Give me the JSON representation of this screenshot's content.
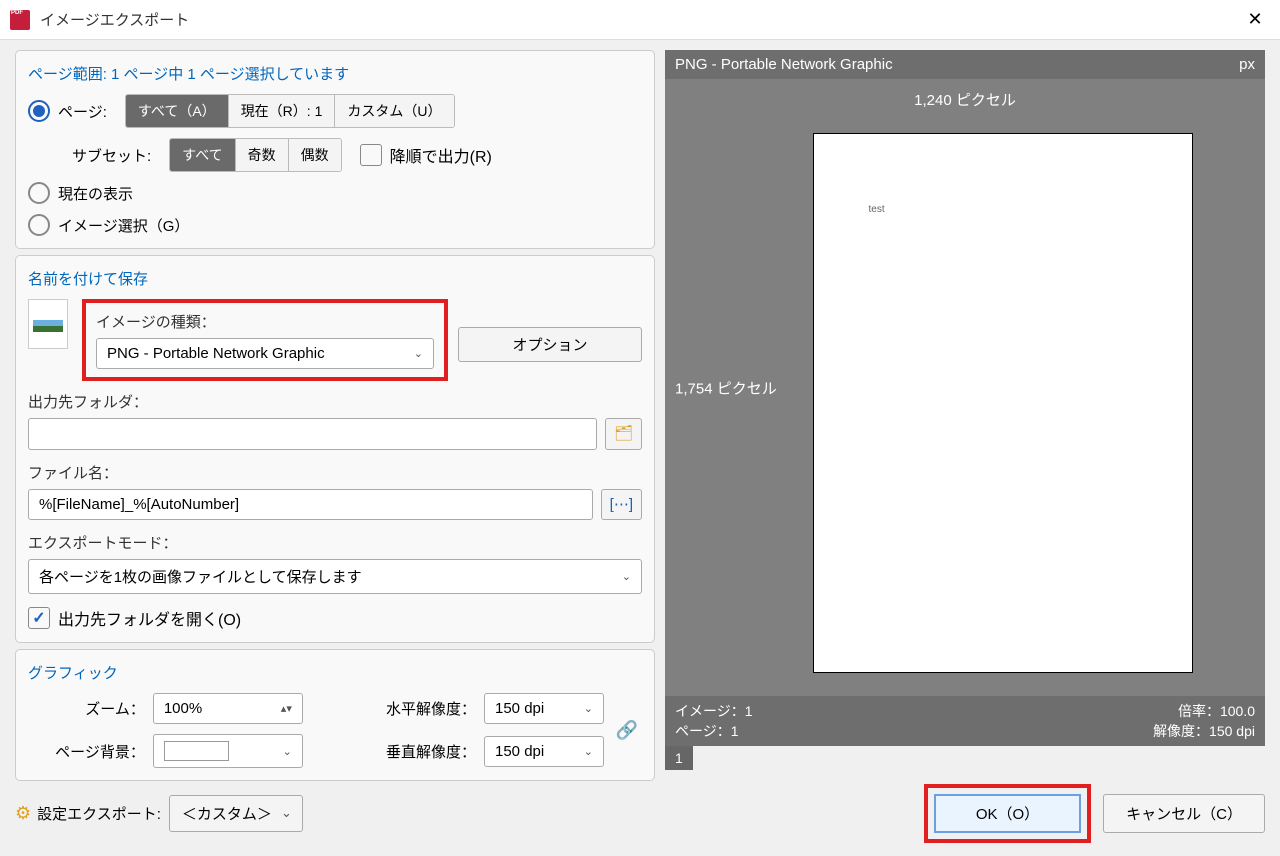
{
  "titlebar": {
    "title": "イメージエクスポート"
  },
  "page_range": {
    "title": "ページ範囲: 1 ページ中 1 ページ選択しています",
    "radio_pages": "ページ:",
    "seg_all": "すべて（A）",
    "seg_current": "現在（R）: 1",
    "seg_custom": "カスタム（U）",
    "subset_label": "サブセット:",
    "subset_all": "すべて",
    "subset_odd": "奇数",
    "subset_even": "偶数",
    "reverse_label": "降順で出力(R)",
    "radio_current_view": "現在の表示",
    "radio_image_sel": "イメージ選択（G）"
  },
  "save_as": {
    "title": "名前を付けて保存",
    "image_type_label": "イメージの種類：",
    "image_type_value": "PNG - Portable Network Graphic",
    "options_btn": "オプション",
    "output_folder_label": "出力先フォルダ：",
    "output_folder_value": "",
    "filename_label": "ファイル名：",
    "filename_value": "%[FileName]_%[AutoNumber]",
    "macro_btn": "[⋯]",
    "export_mode_label": "エクスポートモード：",
    "export_mode_value": "各ページを1枚の画像ファイルとして保存します",
    "open_folder_label": "出力先フォルダを開く(O)"
  },
  "graphics": {
    "title": "グラフィック",
    "zoom_label": "ズーム：",
    "zoom_value": "100%",
    "bg_label": "ページ背景：",
    "hres_label": "水平解像度：",
    "hres_value": "150 dpi",
    "vres_label": "垂直解像度：",
    "vres_value": "150 dpi"
  },
  "preview": {
    "header_title": "PNG - Portable Network Graphic",
    "header_unit": "px",
    "width_label": "1,240 ピクセル",
    "height_label": "1,754 ピクセル",
    "sample_text": "test",
    "image_info": "イメージ：1",
    "page_info": "ページ：1",
    "ratio_info": "倍率：100.0",
    "res_info": "解像度：150 dpi",
    "tab_1": "1"
  },
  "bottom": {
    "settings_label": "設定エクスポート:",
    "settings_value": "＜カスタム＞",
    "ok": "OK（O）",
    "cancel": "キャンセル（C）"
  }
}
